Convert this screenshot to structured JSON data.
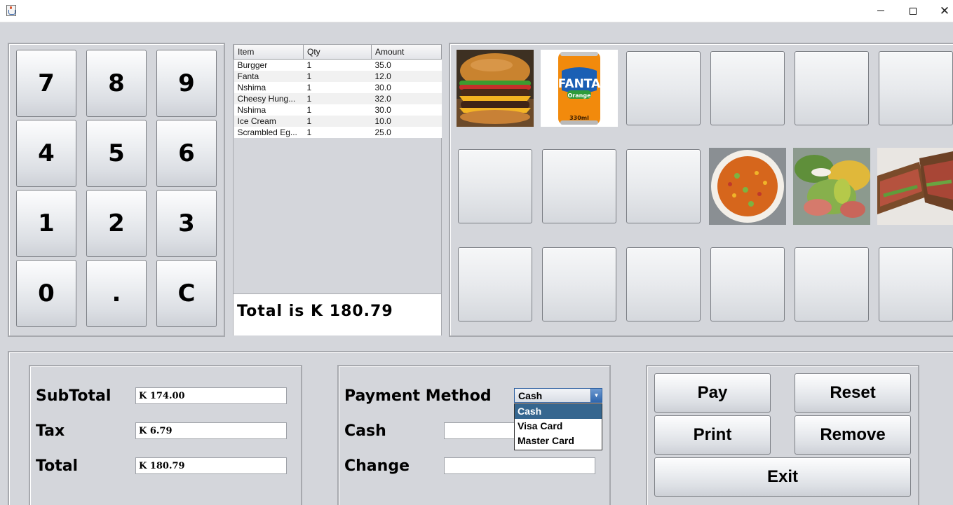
{
  "window": {
    "title": ""
  },
  "keypad": [
    "7",
    "8",
    "9",
    "4",
    "5",
    "6",
    "1",
    "2",
    "3",
    "0",
    ".",
    "C"
  ],
  "orders": {
    "columns": [
      "Item",
      "Qty",
      "Amount"
    ],
    "rows": [
      [
        "Burgger",
        "1",
        "35.0"
      ],
      [
        "Fanta",
        "1",
        "12.0"
      ],
      [
        "Nshima",
        "1",
        "30.0"
      ],
      [
        "Cheesy Hung...",
        "1",
        "32.0"
      ],
      [
        "Nshima",
        "1",
        "30.0"
      ],
      [
        "Ice Cream",
        "1",
        "10.0"
      ],
      [
        "Scrambled Eg...",
        "1",
        "25.0"
      ]
    ],
    "total_text": "Total is K 180.79"
  },
  "menu_items": [
    {
      "name": "burger-image",
      "icon": "burger"
    },
    {
      "name": "fanta-image",
      "icon": "fanta-orange-can",
      "text": "FANTA",
      "subtext": "Orange",
      "size": "330ml"
    },
    {
      "name": "fried-rice-image",
      "icon": "fried-rice"
    },
    {
      "name": "salad-image",
      "icon": "salad"
    },
    {
      "name": "sandwich-image",
      "icon": "sandwich"
    }
  ],
  "totals": {
    "subtotal_label": "SubTotal",
    "subtotal_value": "K 174.00",
    "tax_label": "Tax",
    "tax_value": "K 6.79",
    "total_label": "Total",
    "total_value": "K 180.79"
  },
  "payment": {
    "method_label": "Payment Method",
    "selected": "Cash",
    "options": [
      "Cash",
      "Visa Card",
      "Master Card"
    ],
    "cash_label": "Cash",
    "cash_value": "",
    "change_label": "Change",
    "change_value": ""
  },
  "actions": {
    "pay": "Pay",
    "reset": "Reset",
    "print": "Print",
    "remove": "Remove",
    "exit": "Exit"
  }
}
